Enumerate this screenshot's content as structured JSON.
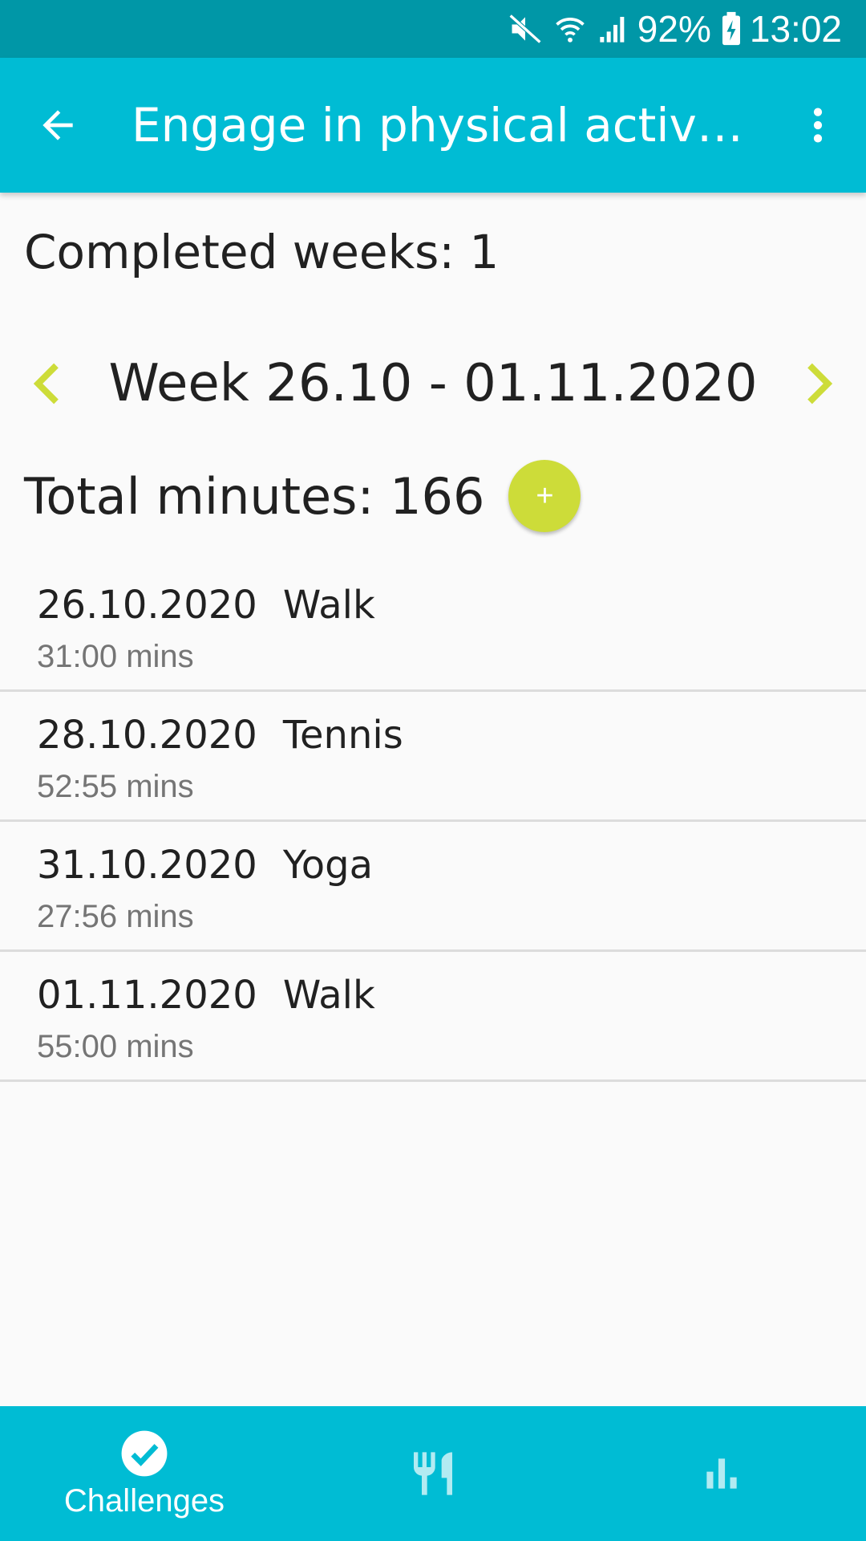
{
  "status_bar": {
    "battery": "92%",
    "time": "13:02",
    "icons": [
      "mute-icon",
      "wifi-icon",
      "signal-icon",
      "battery-charging-icon"
    ]
  },
  "app_bar": {
    "title": "Engage in physical activit…",
    "back_icon": "arrow-back-icon",
    "menu_icon": "more-vert-icon"
  },
  "summary": {
    "completed_weeks": "Completed weeks: 1"
  },
  "week_nav": {
    "label": "Week 26.10 - 01.11.2020",
    "prev_icon": "chevron-left-icon",
    "next_icon": "chevron-right-icon"
  },
  "totals": {
    "label": "Total minutes: 166",
    "add_symbol": "+"
  },
  "activities": [
    {
      "date": "26.10.2020",
      "name": "Walk",
      "duration": "31:00 mins"
    },
    {
      "date": "28.10.2020",
      "name": "Tennis",
      "duration": "52:55 mins"
    },
    {
      "date": "31.10.2020",
      "name": "Yoga",
      "duration": "27:56 mins"
    },
    {
      "date": "01.11.2020",
      "name": "Walk",
      "duration": "55:00 mins"
    }
  ],
  "bottom_nav": {
    "tabs": [
      {
        "label": "Challenges",
        "icon": "check-circle-icon",
        "active": true
      },
      {
        "label": "",
        "icon": "restaurant-icon",
        "active": false
      },
      {
        "label": "",
        "icon": "bar-chart-icon",
        "active": false
      }
    ]
  },
  "colors": {
    "primary": "#00bcd4",
    "primary_dark": "#0097a7",
    "accent": "#cddc39"
  }
}
